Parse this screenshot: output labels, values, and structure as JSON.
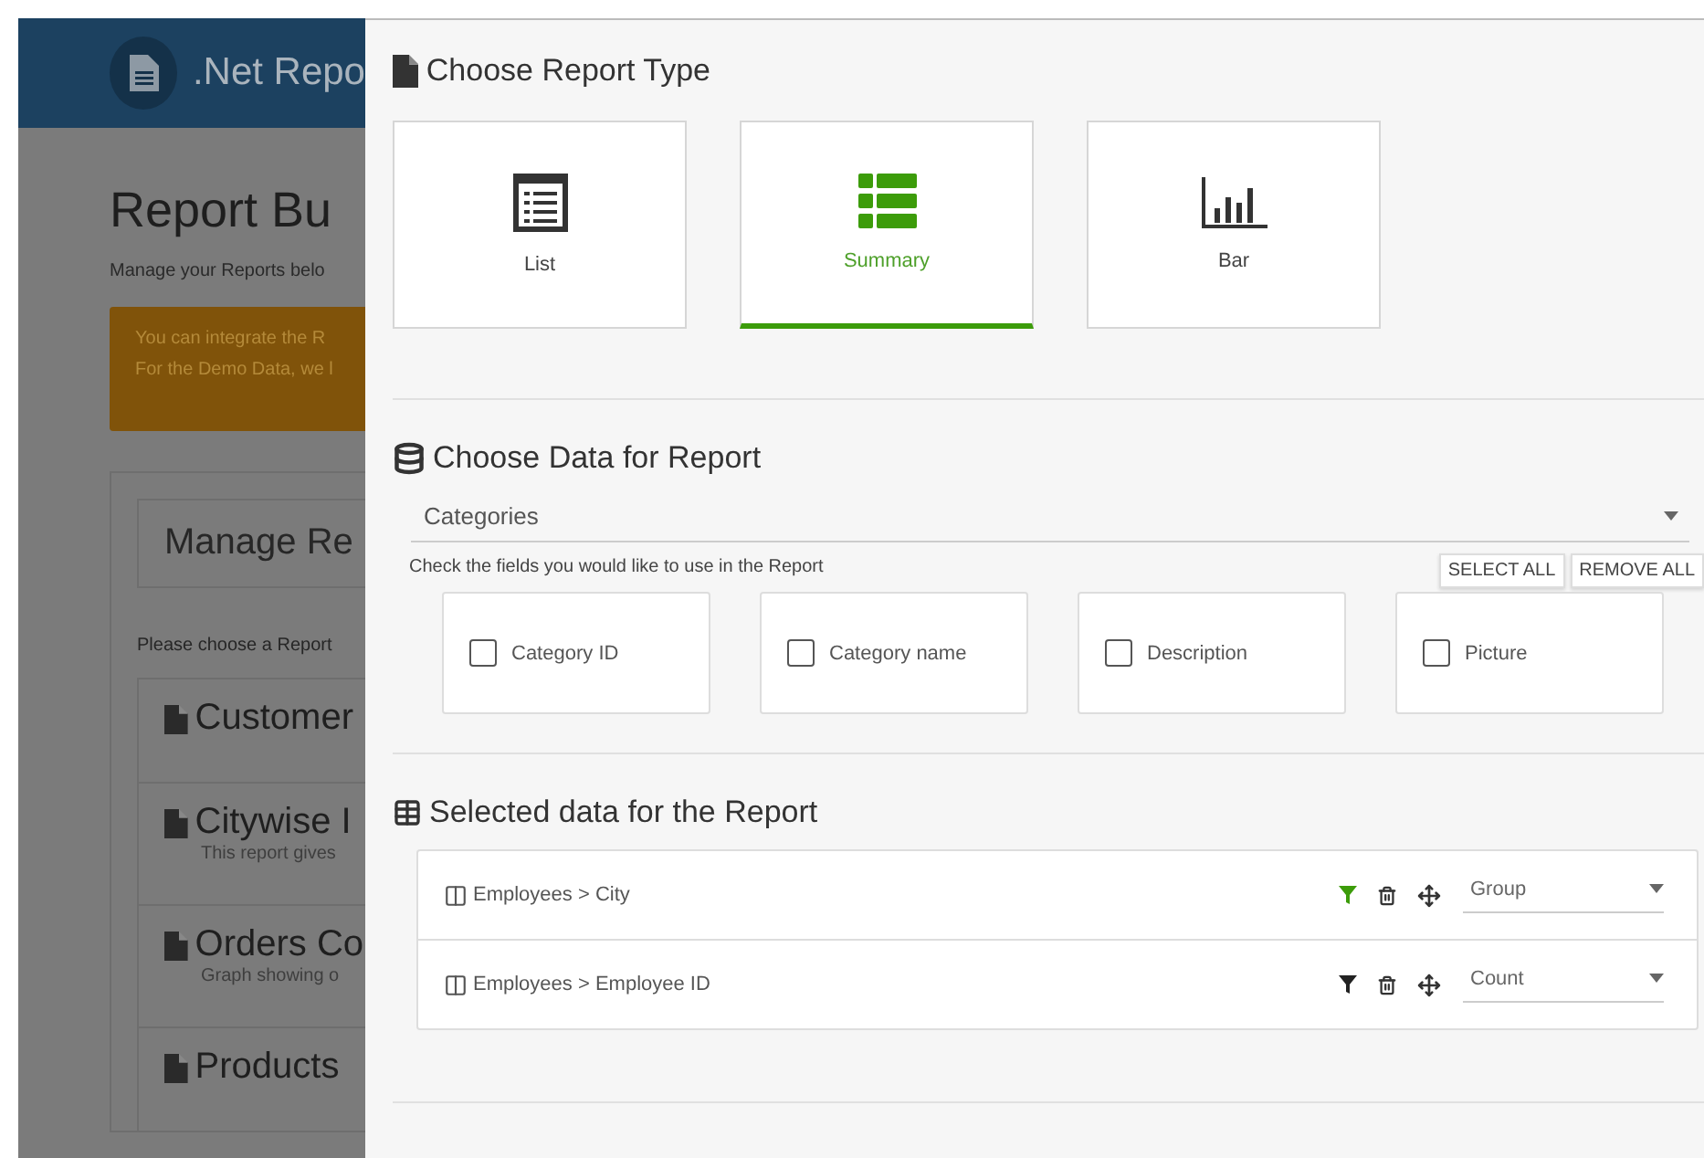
{
  "background": {
    "app_title": ".Net Repo",
    "page_title": "Report Bu",
    "subtitle": "Manage your Reports belo",
    "alert_lines": [
      "You can integrate the R",
      "For the Demo Data, we l"
    ],
    "manage_heading": "Manage Re",
    "prompt": "Please choose a Report",
    "reports": [
      {
        "name": "Customer"
      },
      {
        "name": "Citywise I",
        "description": "This report gives"
      },
      {
        "name": "Orders Co",
        "description": "Graph showing o"
      },
      {
        "name": "Products"
      }
    ]
  },
  "report_type": {
    "title": "Choose Report Type",
    "types": [
      {
        "label": "List",
        "kind": "list",
        "selected": false
      },
      {
        "label": "Summary",
        "kind": "summary",
        "selected": true
      },
      {
        "label": "Bar",
        "kind": "bar",
        "selected": false
      }
    ]
  },
  "data_source": {
    "title": "Choose Data for Report",
    "dropdown": "Categories",
    "hint": "Check the fields you would like to use in the Report",
    "buttons": [
      "SELECT ALL",
      "REMOVE ALL"
    ],
    "fields": [
      {
        "label": "Category ID",
        "checked": false
      },
      {
        "label": "Category name",
        "checked": false
      },
      {
        "label": "Description",
        "checked": false
      },
      {
        "label": "Picture",
        "checked": false
      }
    ]
  },
  "selected_data": {
    "title": "Selected data for the Report",
    "rows": [
      {
        "field": "Employees > City",
        "filter_active": true,
        "aggregate": "Group"
      },
      {
        "field": "Employees > Employee ID",
        "filter_active": false,
        "aggregate": "Count"
      }
    ]
  }
}
